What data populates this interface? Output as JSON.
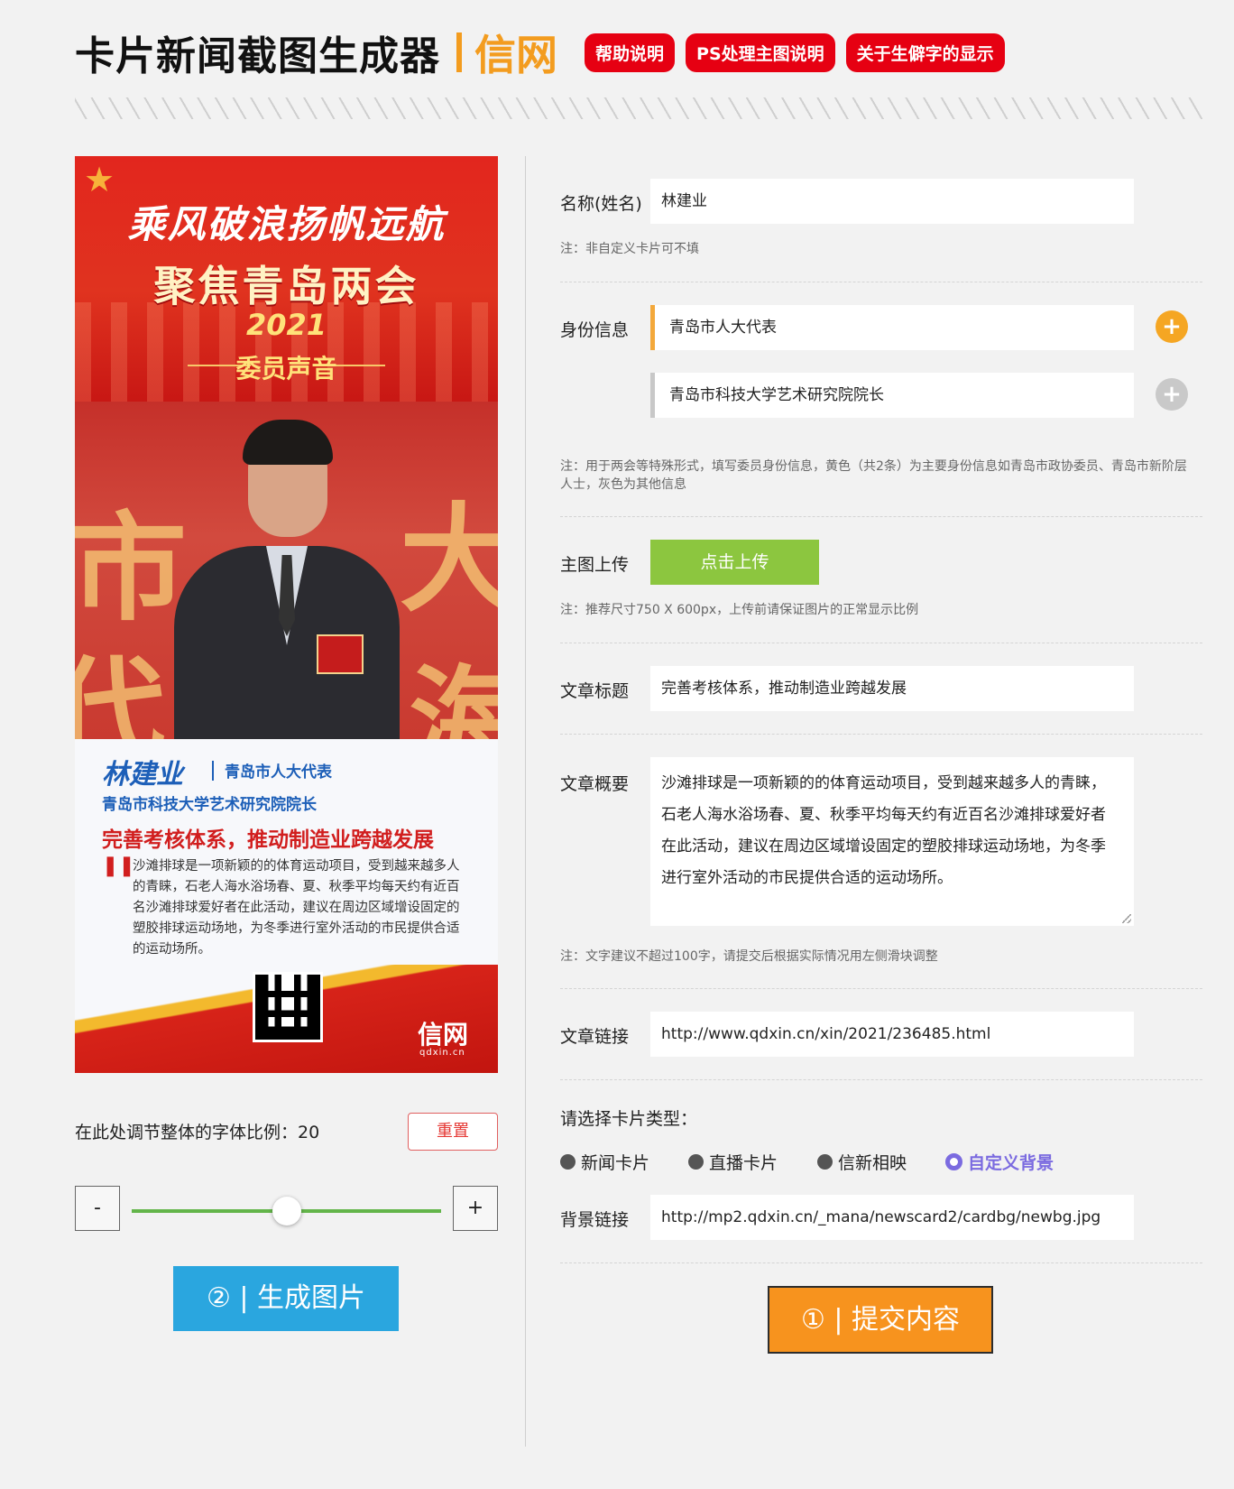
{
  "header": {
    "title": "卡片新闻截图生成器",
    "brand": "信网",
    "help_label": "帮助说明",
    "ps_label": "PS处理主图说明",
    "rare_char_label": "关于生僻字的显示"
  },
  "card": {
    "slogan": "乘风破浪扬帆远航",
    "theme": "聚焦青岛两会",
    "year": "2021",
    "voice": "委员声音",
    "name": "林建业",
    "rep": "青岛市人大代表",
    "role": "青岛市科技大学艺术研究院院长",
    "title": "完善考核体系，推动制造业跨越发展",
    "summary": "沙滩排球是一项新颖的的体育运动项目，受到越来越多人的青睐，石老人海水浴场春、夏、秋季平均每天约有近百名沙滩排球爱好者在此活动，建议在周边区域增设固定的塑胶排球运动场地，为冬季进行室外活动的市民提供合适的运动场所。",
    "logo": "信网",
    "logo_sub": "qdxin.cn"
  },
  "controls": {
    "font_scale_label": "在此处调节整体的字体比例：20",
    "reset_label": "重置",
    "minus_label": "-",
    "plus_label": "+",
    "font_scale_value": 20,
    "generate_label": "② | 生成图片"
  },
  "form": {
    "name_label": "名称(姓名)",
    "name_value": "林建业",
    "name_note": "注：非自定义卡片可不填",
    "identity_label": "身份信息",
    "identity_primary": "青岛市人大代表",
    "identity_secondary": "青岛市科技大学艺术研究院院长",
    "identity_note": "注：用于两会等特殊形式，填写委员身份信息，黄色（共2条）为主要身份信息如青岛市政协委员、青岛市新阶层人士，灰色为其他信息",
    "upload_label": "主图上传",
    "upload_button": "点击上传",
    "upload_note": "注：推荐尺寸750 X 600px，上传前请保证图片的正常显示比例",
    "article_title_label": "文章标题",
    "article_title_value": "完善考核体系，推动制造业跨越发展",
    "summary_label": "文章概要",
    "summary_value": "沙滩排球是一项新颖的的体育运动项目，受到越来越多人的青睐，石老人海水浴场春、夏、秋季平均每天约有近百名沙滩排球爱好者在此活动，建议在周边区域增设固定的塑胶排球运动场地，为冬季进行室外活动的市民提供合适的运动场所。",
    "summary_note": "注：文字建议不超过100字，请提交后根据实际情况用左侧滑块调整",
    "link_label": "文章链接",
    "link_value": "http://www.qdxin.cn/xin/2021/236485.html",
    "card_type_label": "请选择卡片类型：",
    "card_types": [
      "新闻卡片",
      "直播卡片",
      "信新相映",
      "自定义背景"
    ],
    "bg_link_label": "背景链接",
    "bg_link_value": "http://mp2.qdxin.cn/_mana/newscard2/cardbg/newbg.jpg",
    "submit_label": "① | 提交内容"
  }
}
